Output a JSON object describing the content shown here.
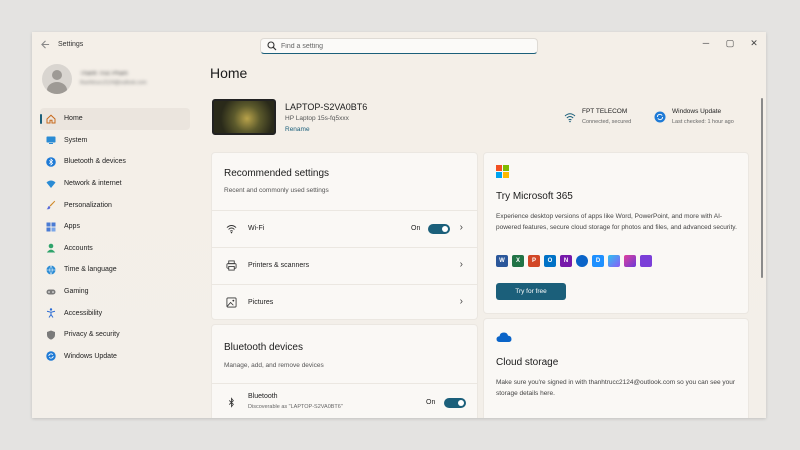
{
  "window": {
    "app_title": "Settings",
    "back_icon": "back-arrow-icon",
    "controls": {
      "minimize": "─",
      "maximize": "▢",
      "close": "✕"
    }
  },
  "search": {
    "placeholder": "Find a setting"
  },
  "profile": {
    "name": "Thanh Truc Pham",
    "email": "thanhtrucc2124@outlook.com"
  },
  "nav": [
    {
      "label": "Home",
      "icon": "home-icon",
      "active": true
    },
    {
      "label": "System",
      "icon": "system-icon"
    },
    {
      "label": "Bluetooth & devices",
      "icon": "bluetooth-icon"
    },
    {
      "label": "Network & internet",
      "icon": "network-icon"
    },
    {
      "label": "Personalization",
      "icon": "brush-icon"
    },
    {
      "label": "Apps",
      "icon": "apps-icon"
    },
    {
      "label": "Accounts",
      "icon": "accounts-icon"
    },
    {
      "label": "Time & language",
      "icon": "globe-icon"
    },
    {
      "label": "Gaming",
      "icon": "gamepad-icon"
    },
    {
      "label": "Accessibility",
      "icon": "accessibility-icon"
    },
    {
      "label": "Privacy & security",
      "icon": "shield-icon"
    },
    {
      "label": "Windows Update",
      "icon": "update-icon"
    }
  ],
  "main": {
    "title": "Home",
    "device": {
      "name": "LAPTOP-S2VA0BT6",
      "model": "HP Laptop 15s-fq5xxx",
      "rename": "Rename"
    },
    "network": {
      "title": "FPT TELECOM",
      "subtitle": "Connected, secured"
    },
    "update": {
      "title": "Windows Update",
      "subtitle": "Last checked: 1 hour ago"
    },
    "recommended": {
      "title": "Recommended settings",
      "subtitle": "Recent and commonly used settings",
      "rows": [
        {
          "label": "Wi-Fi",
          "toggle": "On"
        },
        {
          "label": "Printers & scanners"
        },
        {
          "label": "Pictures"
        }
      ]
    },
    "bluetooth": {
      "title": "Bluetooth devices",
      "subtitle": "Manage, add, and remove devices",
      "row": {
        "label": "Bluetooth",
        "sub": "Discoverable as \"LAPTOP-S2VA0BT6\"",
        "toggle": "On"
      }
    },
    "m365": {
      "title": "Try Microsoft 365",
      "description": "Experience desktop versions of apps like Word, PowerPoint, and more with AI-powered features, secure cloud storage for photos and files, and advanced security.",
      "button": "Try for free",
      "apps": [
        "W",
        "X",
        "P",
        "O",
        "N",
        "",
        "D",
        "",
        "",
        ""
      ]
    },
    "cloud": {
      "title": "Cloud storage",
      "description": "Make sure you're signed in with thanhtrucc2124@outlook.com so you can see your storage details here."
    }
  },
  "colors": {
    "accent": "#1b5f7a",
    "background": "#f4efe8",
    "card": "#faf8f5"
  }
}
